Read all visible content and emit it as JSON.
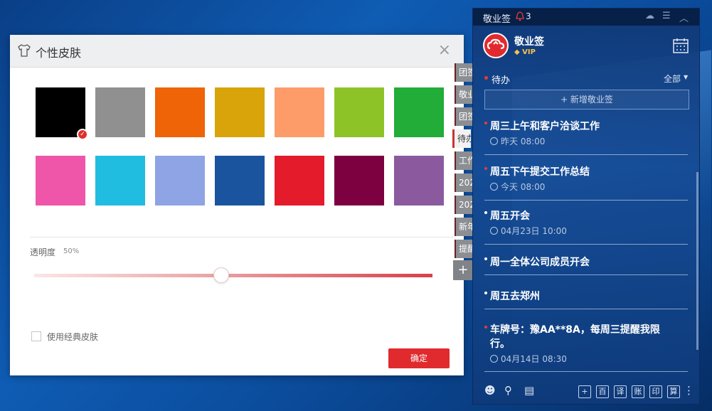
{
  "dialog": {
    "title": "个性皮肤",
    "close_label": "×",
    "swatches": [
      {
        "color": "#000000",
        "selected": true
      },
      {
        "color": "#909090",
        "selected": false
      },
      {
        "color": "#ee6407",
        "selected": false
      },
      {
        "color": "#d8a40a",
        "selected": false
      },
      {
        "color": "#fd9b69",
        "selected": false
      },
      {
        "color": "#8ec327",
        "selected": false
      },
      {
        "color": "#22ac38",
        "selected": false
      },
      {
        "color": "#ef56aa",
        "selected": false
      },
      {
        "color": "#20bde0",
        "selected": false
      },
      {
        "color": "#8ea4e4",
        "selected": false
      },
      {
        "color": "#1a549f",
        "selected": false
      },
      {
        "color": "#e31b2a",
        "selected": false
      },
      {
        "color": "#7d0041",
        "selected": false
      },
      {
        "color": "#8b5a9e",
        "selected": false
      }
    ],
    "opacity_label": "透明度",
    "opacity_value": "50%",
    "opacity_level": 0.5,
    "classic_skin_label": "使用经典皮肤",
    "confirm_label": "确定"
  },
  "side_tabs": [
    "团签",
    "敬业",
    "团签",
    "待办",
    "工作",
    "202",
    "202",
    "新年",
    "提醒"
  ],
  "side_active_index": 3,
  "side_add_label": "+",
  "panel": {
    "app_name": "敬业签",
    "notification_count": "3",
    "user_name": "敬业签",
    "vip_label": "VIP",
    "section_title": "待办",
    "filter_label": "全部",
    "new_note_label": "+ 新增敬业签",
    "items": [
      {
        "title": "周三上午和客户洽谈工作",
        "time": "昨天 08:00",
        "dot": "#e83b3b"
      },
      {
        "title": "周五下午提交工作总结",
        "time": "今天 08:00",
        "dot": "#e83b3b"
      },
      {
        "title": "周五开会",
        "time": "04月23日 10:00",
        "dot": "#ffffff"
      },
      {
        "title": "周一全体公司成员开会",
        "time": "",
        "dot": "#ffffff"
      },
      {
        "title": "周五去郑州",
        "time": "",
        "dot": "#ffffff"
      },
      {
        "title": "车牌号：豫AA**8A，每周三提醒我限行。",
        "time": "04月14日 08:30",
        "dot": "#e83b3b"
      }
    ],
    "bottom_tools": [
      "+",
      "百",
      "译",
      "账",
      "印",
      "算"
    ]
  }
}
